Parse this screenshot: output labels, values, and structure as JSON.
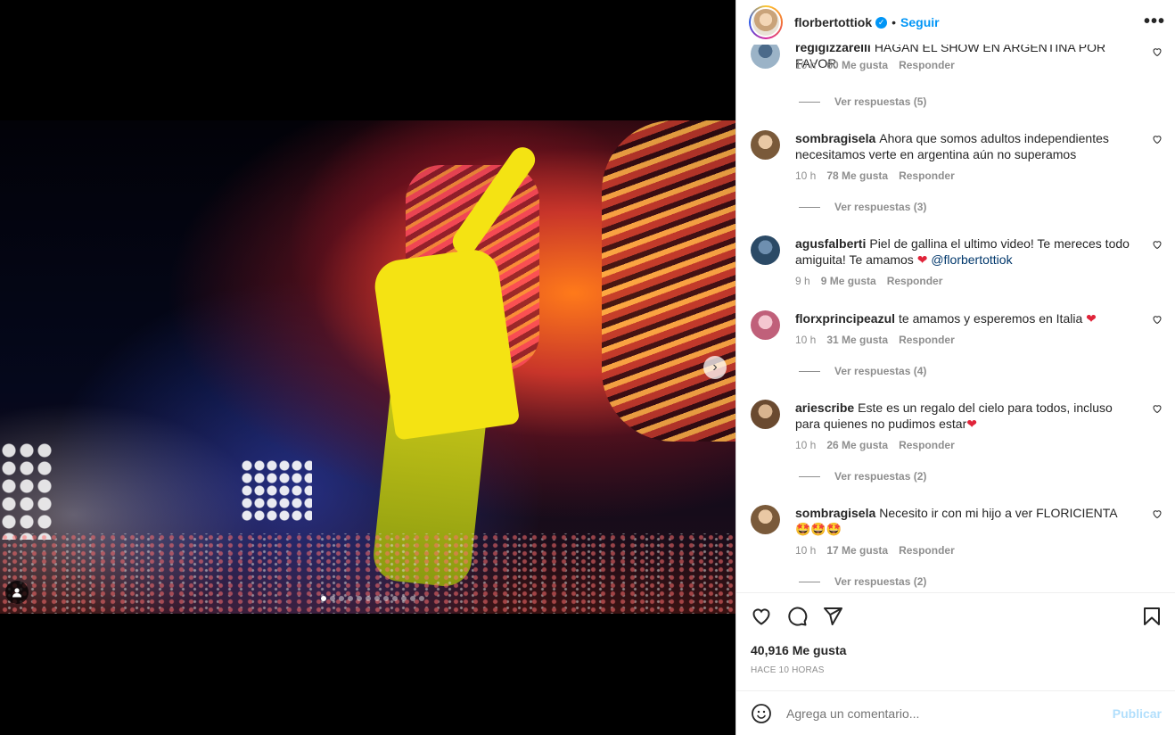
{
  "post": {
    "username": "florbertottiok",
    "follow_label": "Seguir",
    "separator": "•",
    "more_label": "•••",
    "likes": "40,916 Me gusta",
    "time": "Hace 10 horas",
    "comment_placeholder": "Agrega un comentario...",
    "post_label": "Publicar"
  },
  "media": {
    "next_arrow": "›"
  },
  "comments": [
    {
      "user": "regigizzarelli",
      "text": "HAGAN EL SHOW EN ARGENTINA POR FAVOR",
      "time": "10 h",
      "likes": "60 Me gusta",
      "reply": "Responder",
      "replies": "Ver respuestas (5)"
    },
    {
      "user": "sombragisela",
      "text": "Ahora que somos adultos independientes necesitamos verte en argentina aún no superamos",
      "time": "10 h",
      "likes": "78 Me gusta",
      "reply": "Responder",
      "replies": "Ver respuestas (3)"
    },
    {
      "user": "agusfalberti",
      "text": "Piel de gallina el ultimo video! Te mereces todo amiguita! Te amamos ",
      "heart": "❤",
      "mention": "@florbertottiok",
      "time": "9 h",
      "likes": "9 Me gusta",
      "reply": "Responder"
    },
    {
      "user": "florxprincipeazul",
      "text": "te amamos y esperemos en Italia ",
      "heart": "❤",
      "time": "10 h",
      "likes": "31 Me gusta",
      "reply": "Responder",
      "replies": "Ver respuestas (4)"
    },
    {
      "user": "ariescribe",
      "text": "Este es un regalo del cielo para todos, incluso para quienes no pudimos estar",
      "heart": "❤",
      "time": "10 h",
      "likes": "26 Me gusta",
      "reply": "Responder",
      "replies": "Ver respuestas (2)"
    },
    {
      "user": "sombragisela",
      "text": "Necesito ir con mi hijo a ver FLORICIENTA ",
      "emojis": "🤩🤩🤩",
      "time": "10 h",
      "likes": "17 Me gusta",
      "reply": "Responder",
      "replies": "Ver respuestas (2)"
    }
  ],
  "colors": {
    "accent": "#0095f6",
    "muted": "#8e8e8e",
    "text": "#262626",
    "post_disabled": "#b2dffc"
  }
}
